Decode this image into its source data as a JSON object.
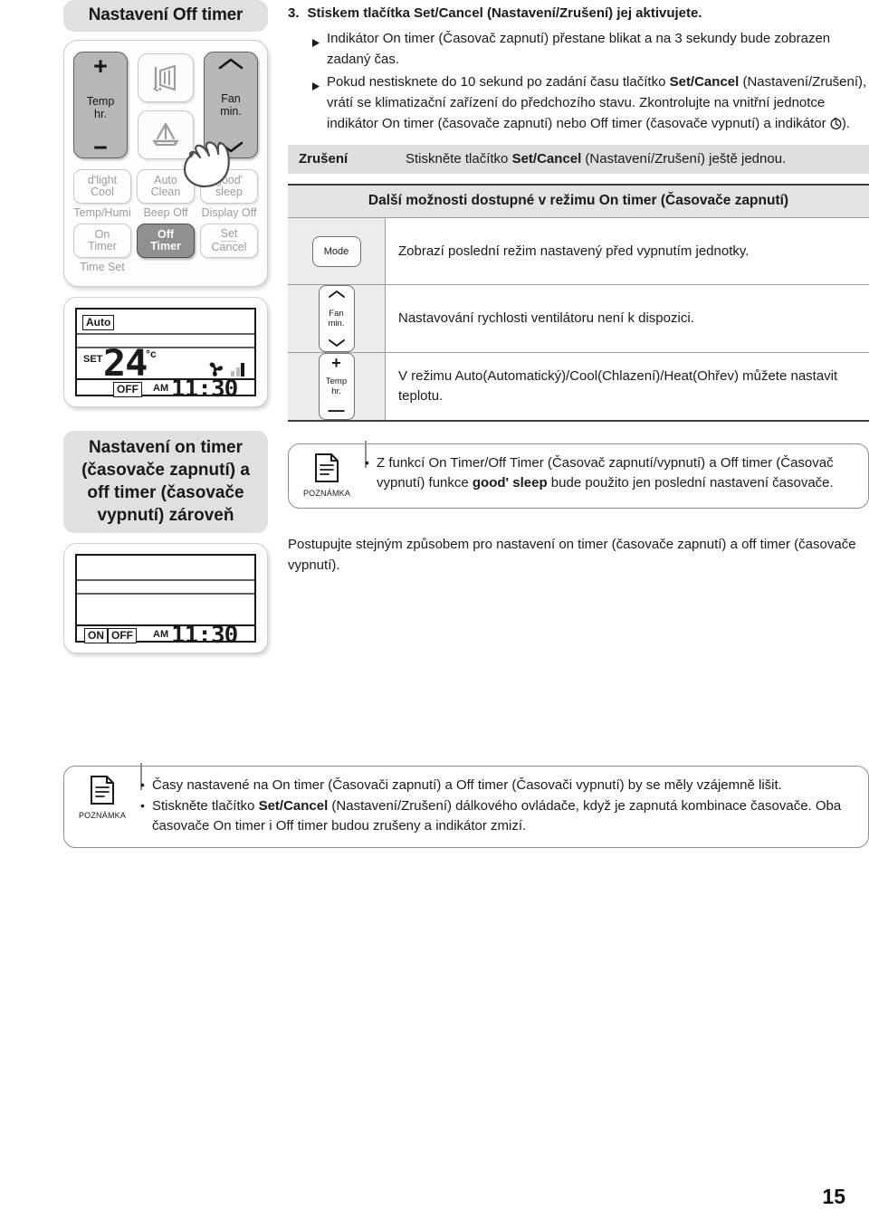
{
  "page": {
    "number": "15"
  },
  "left": {
    "title_off": "Nastavení Off timer",
    "title_on_off": "Nastavení on timer (časovače zapnutí) a off timer (časovače vypnutí) zároveň",
    "remote": {
      "temp_button": {
        "plus": "+",
        "line1": "Temp",
        "line2": "hr.",
        "minus": "−"
      },
      "fan_button": {
        "line1": "Fan",
        "line2": "min."
      },
      "swing_vertical_icon": "swing-vertical-icon",
      "swing_horizontal_icon": "swing-horizontal-icon",
      "buttons": [
        {
          "name": "dlight-cool",
          "line1": "d'light",
          "line2": "Cool",
          "sub": "Temp/Humi",
          "active": false
        },
        {
          "name": "auto-clean",
          "line1": "Auto",
          "line2": "Clean",
          "sub": "Beep Off",
          "active": false
        },
        {
          "name": "good-sleep",
          "line1": "good'",
          "line2": "sleep",
          "sub": "Display Off",
          "active": false
        },
        {
          "name": "on-timer",
          "line1": "On",
          "line2": "Timer",
          "sub": "Time Set",
          "active": false
        },
        {
          "name": "off-timer",
          "line1": "Off",
          "line2": "Timer",
          "sub": "",
          "active": true
        },
        {
          "name": "set-cancel",
          "line1": "Set",
          "line2": "Cancel",
          "sub": "",
          "active": false
        }
      ]
    },
    "lcd1": {
      "mode": "Auto",
      "set_label": "SET",
      "temperature": "24",
      "degree": "°c",
      "fan_icon": "fan-icon",
      "fan_bars": "2",
      "timer_state": "OFF",
      "meridiem": "AM",
      "time": "11:30"
    },
    "lcd2": {
      "on_label": "ON",
      "off_label": "OFF",
      "meridiem": "AM",
      "time": "11:30"
    }
  },
  "right": {
    "step": {
      "number": "3.",
      "text_a": "Stiskem tlačítka ",
      "text_b": "Set/Cancel",
      "text_c": " (Nastavení/Zrušení) jej aktivujete."
    },
    "bullets": [
      "Indikátor On timer (Časovač zapnutí) přestane blikat a na 3 sekundy bude zobrazen zadaný čas.",
      "Pokud nestisknete do 10 sekund po zadání času tlačítko Set/Cancel (Nastavení/Zrušení), vrátí se klimatizační zařízení do předchozího stavu. Zkontrolujte na vnitřní jednotce indikátor On timer (časovače zapnutí) nebo Off timer (časovače vypnutí) a indikátor ."
    ],
    "cancel_row": {
      "label": "Zrušení",
      "text_a": "Stiskněte tlačítko ",
      "text_b": "Set/Cancel",
      "text_c": " (Nastavení/Zrušení) ještě jednou."
    },
    "table": {
      "header": "Další možnosti dostupné v režimu On timer (Časovače zapnutí)",
      "rows": [
        {
          "icon_label": "Mode",
          "icon_name": "mode-button-icon",
          "text": "Zobrazí poslední režim nastavený před vypnutím jednotky."
        },
        {
          "icon_label": "Fan min.",
          "icon_name": "fan-button-icon",
          "text": "Nastavování rychlosti ventilátoru není k dispozici."
        },
        {
          "icon_label": "Temp hr.",
          "icon_name": "temp-button-icon",
          "text": "V režimu Auto(Automatický)/Cool(Chlazení)/Heat(Ohřev) můžete nastavit teplotu."
        }
      ]
    },
    "note1": {
      "caption": "POZNÁMKA",
      "icon": "note-document-icon",
      "items_html": [
        {
          "a": "Z funkcí On Timer/Off Timer (Časovač zapnutí/vypnutí) a Off timer (Časovač vypnutí) funkce ",
          "b": "good' sleep",
          "c": " bude použito jen poslední nastavení časovače."
        }
      ]
    },
    "paragraph": "Postupujte stejným způsobem pro nastavení on timer (časovače zapnutí) a off timer (časovače vypnutí)."
  },
  "bottom_note": {
    "caption": "POZNÁMKA",
    "icon": "note-document-icon",
    "item1": "Časy nastavené na On timer (Časovači zapnutí) a Off timer (Časovači vypnutí) by se měly vzájemně lišit.",
    "item2": {
      "a": "Stiskněte tlačítko ",
      "b": "Set/Cancel",
      "c": " (Nastavení/Zrušení) dálkového ovládače, když je zapnutá kombinace časovače. Oba časovače On timer i Off timer budou zrušeny a indikátor zmizí."
    }
  },
  "colors": {
    "panel_gray": "#dfe0e1",
    "button_dark": "#8f9091",
    "button_mid": "#b6b7b8",
    "row_gray": "#dddedf",
    "rule": "#9a9c9e"
  }
}
